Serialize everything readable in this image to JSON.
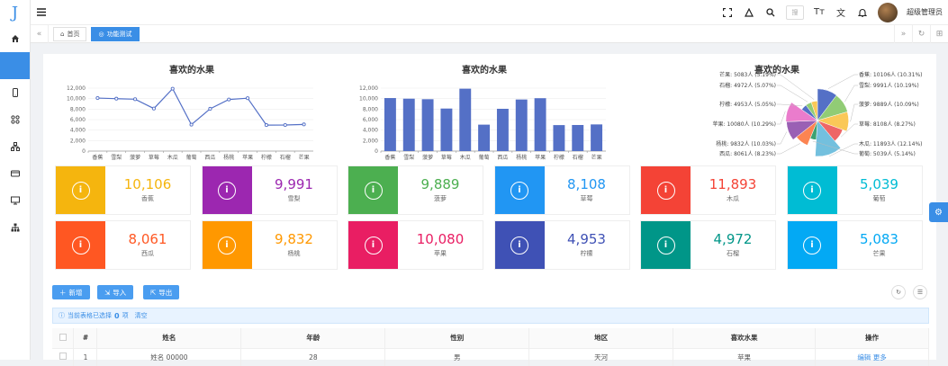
{
  "sidebar": {
    "logo": "J",
    "items": [
      {
        "icon": "home-icon"
      },
      {
        "icon": "blank",
        "active": true
      },
      {
        "icon": "phone-icon"
      },
      {
        "icon": "apps-icon"
      },
      {
        "icon": "network-icon"
      },
      {
        "icon": "card-icon"
      },
      {
        "icon": "screen-icon"
      },
      {
        "icon": "sitemap-icon"
      }
    ]
  },
  "header": {
    "search_placeholder": "搜",
    "username": "超级管理员"
  },
  "tabs": [
    {
      "label": "首页",
      "icon": "⌂"
    },
    {
      "label": "功能测试",
      "icon": "◎",
      "active": true
    }
  ],
  "charts": {
    "line_title": "喜欢的水果",
    "bar_title": "喜欢的水果",
    "pie_title": "喜欢的水果"
  },
  "chart_data": [
    {
      "type": "line",
      "title": "喜欢的水果",
      "categories": [
        "香蕉",
        "雪梨",
        "菠萝",
        "草莓",
        "木瓜",
        "葡萄",
        "西瓜",
        "杨桃",
        "苹果",
        "柠檬",
        "石榴",
        "芒果"
      ],
      "values": [
        10106,
        9991,
        9889,
        8108,
        11893,
        5039,
        8061,
        9832,
        10080,
        4953,
        4972,
        5083
      ],
      "yticks": [
        "12,000",
        "10,000",
        "8,000",
        "6,000",
        "4,000",
        "2,000",
        "0"
      ],
      "ylim": [
        0,
        12000
      ]
    },
    {
      "type": "bar",
      "title": "喜欢的水果",
      "categories": [
        "香蕉",
        "雪梨",
        "菠萝",
        "草莓",
        "木瓜",
        "葡萄",
        "西瓜",
        "杨桃",
        "苹果",
        "柠檬",
        "石榴",
        "芒果"
      ],
      "values": [
        10106,
        9991,
        9889,
        8108,
        11893,
        5039,
        8061,
        9832,
        10080,
        4953,
        4972,
        5083
      ],
      "yticks": [
        "12,000",
        "10,000",
        "8,000",
        "6,000",
        "4,000",
        "2,000",
        "0"
      ],
      "ylim": [
        0,
        12000
      ]
    },
    {
      "type": "pie",
      "title": "喜欢的水果",
      "labels": [
        "香蕉: 10106人 (10.31%)",
        "雪梨: 9991人 (10.19%)",
        "菠萝: 9889人 (10.09%)",
        "草莓: 8108人 (8.27%)",
        "木瓜: 11893人 (12.14%)",
        "葡萄: 5039人 (5.14%)",
        "西瓜: 8061人 (8.23%)",
        "杨桃: 9832人 (10.03%)",
        "苹果: 10080人 (10.29%)",
        "柠檬: 4953人 (5.05%)",
        "石榴: 4972人 (5.07%)",
        "芒果: 5083人 (5.19%)"
      ],
      "values": [
        10106,
        9991,
        9889,
        8108,
        11893,
        5039,
        8061,
        9832,
        10080,
        4953,
        4972,
        5083
      ],
      "colors": [
        "#5470c6",
        "#91cc75",
        "#fac858",
        "#ee6666",
        "#73c0de",
        "#3ba272",
        "#fc8452",
        "#9a60b4",
        "#ea7ccc",
        "#5470c6",
        "#91cc75",
        "#fac858"
      ]
    }
  ],
  "cards": [
    {
      "value": "10,106",
      "name": "香蕉",
      "color": "#f5b50e"
    },
    {
      "value": "9,991",
      "name": "雪梨",
      "color": "#9c27b0"
    },
    {
      "value": "9,889",
      "name": "菠萝",
      "color": "#4caf50"
    },
    {
      "value": "8,108",
      "name": "草莓",
      "color": "#2196f3"
    },
    {
      "value": "11,893",
      "name": "木瓜",
      "color": "#f44336"
    },
    {
      "value": "5,039",
      "name": "葡萄",
      "color": "#00bcd4"
    },
    {
      "value": "8,061",
      "name": "西瓜",
      "color": "#ff5722"
    },
    {
      "value": "9,832",
      "name": "杨桃",
      "color": "#ff9800"
    },
    {
      "value": "10,080",
      "name": "苹果",
      "color": "#e91e63"
    },
    {
      "value": "4,953",
      "name": "柠檬",
      "color": "#3f51b5"
    },
    {
      "value": "4,972",
      "name": "石榴",
      "color": "#009688"
    },
    {
      "value": "5,083",
      "name": "芒果",
      "color": "#03a9f4"
    }
  ],
  "toolbar": {
    "add_label": "新增",
    "import_label": "导入",
    "export_label": "导出"
  },
  "selection": {
    "prefix": "当前表格已选择",
    "count": "0",
    "suffix": "项",
    "clear_label": "清空"
  },
  "table": {
    "headers": [
      "#",
      "姓名",
      "年龄",
      "性别",
      "地区",
      "喜欢水果",
      "操作"
    ],
    "rows": [
      {
        "index": "1",
        "name": "姓名 00000",
        "age": "28",
        "gender": "男",
        "region": "天河",
        "fruit": "苹果",
        "actions": [
          "编辑",
          "更多"
        ]
      }
    ]
  }
}
